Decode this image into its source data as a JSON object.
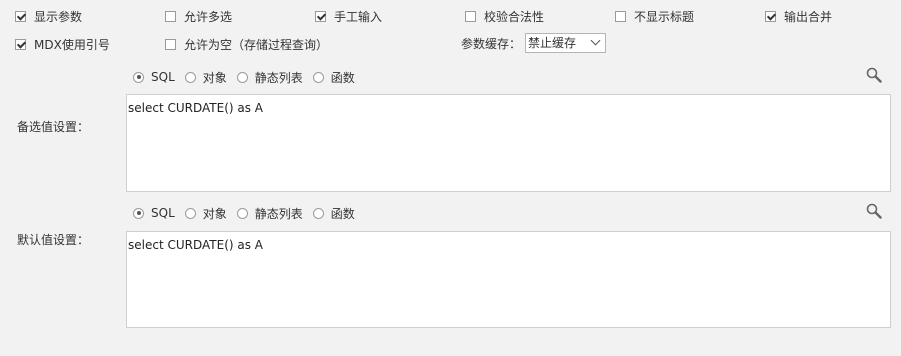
{
  "options": [
    {
      "label": "显示参数",
      "checked": true
    },
    {
      "label": "允许多选",
      "checked": false
    },
    {
      "label": "手工输入",
      "checked": true
    },
    {
      "label": "校验合法性",
      "checked": false
    },
    {
      "label": "不显示标题",
      "checked": false
    },
    {
      "label": "输出合并",
      "checked": true
    },
    {
      "label": "MDX使用引号",
      "checked": true
    },
    {
      "label": "允许为空（存储过程查询）",
      "checked": false
    }
  ],
  "param_cache": {
    "label": "参数缓存：",
    "value": "禁止缓存"
  },
  "candidate": {
    "label": "备选值设置：",
    "source_types": [
      "SQL",
      "对象",
      "静态列表",
      "函数"
    ],
    "selected_type": "SQL",
    "value": "select CURDATE() as A"
  },
  "default": {
    "label": "默认值设置：",
    "source_types": [
      "SQL",
      "对象",
      "静态列表",
      "函数"
    ],
    "selected_type": "SQL",
    "value": "select CURDATE() as A"
  },
  "icons": {
    "search": "search-icon"
  }
}
